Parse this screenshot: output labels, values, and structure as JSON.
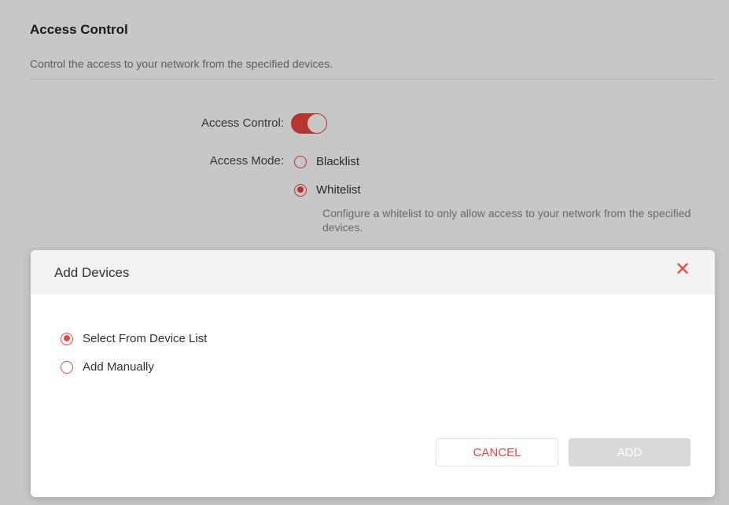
{
  "section": {
    "title": "Access Control",
    "description": "Control the access to your network from the specified devices."
  },
  "settings": {
    "access_control_label": "Access Control:",
    "access_control_enabled": true,
    "access_mode_label": "Access Mode:",
    "modes": [
      {
        "label": "Blacklist",
        "checked": false
      },
      {
        "label": "Whitelist",
        "checked": true
      }
    ],
    "whitelist_hint": "Configure a whitelist to only allow access to your network from the specified devices."
  },
  "modal": {
    "title": "Add Devices",
    "close_icon": "close-icon",
    "options": [
      {
        "label": "Select From Device List",
        "checked": true
      },
      {
        "label": "Add Manually",
        "checked": false
      }
    ],
    "cancel_label": "CANCEL",
    "add_label": "ADD"
  },
  "colors": {
    "accent": "#e8463e",
    "disabled_button": "#d9d9d9"
  }
}
